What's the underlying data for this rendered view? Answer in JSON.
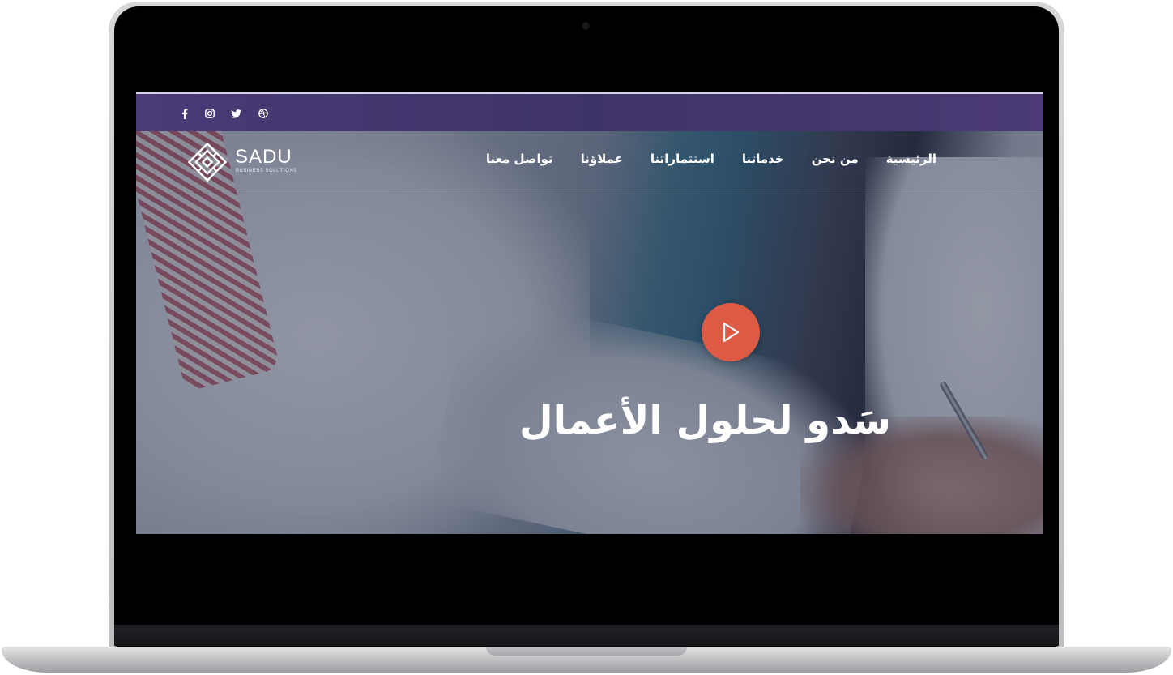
{
  "topbar": {
    "social_icons": [
      "facebook-icon",
      "instagram-icon",
      "twitter-icon",
      "dribbble-icon"
    ],
    "background": "#43356e"
  },
  "brand": {
    "name": "SADU",
    "tagline": "BUSINESS SOLUTIONS"
  },
  "nav": {
    "items": [
      {
        "label": "الرئيسية"
      },
      {
        "label": "من نحن"
      },
      {
        "label": "خدماتنا"
      },
      {
        "label": "استثماراتنا"
      },
      {
        "label": "عملاؤنا"
      },
      {
        "label": "تواصل معنا"
      }
    ]
  },
  "hero": {
    "title": "سَدو لحلول الأعمال",
    "play_icon": "play-icon",
    "play_color": "#dd5a45"
  }
}
